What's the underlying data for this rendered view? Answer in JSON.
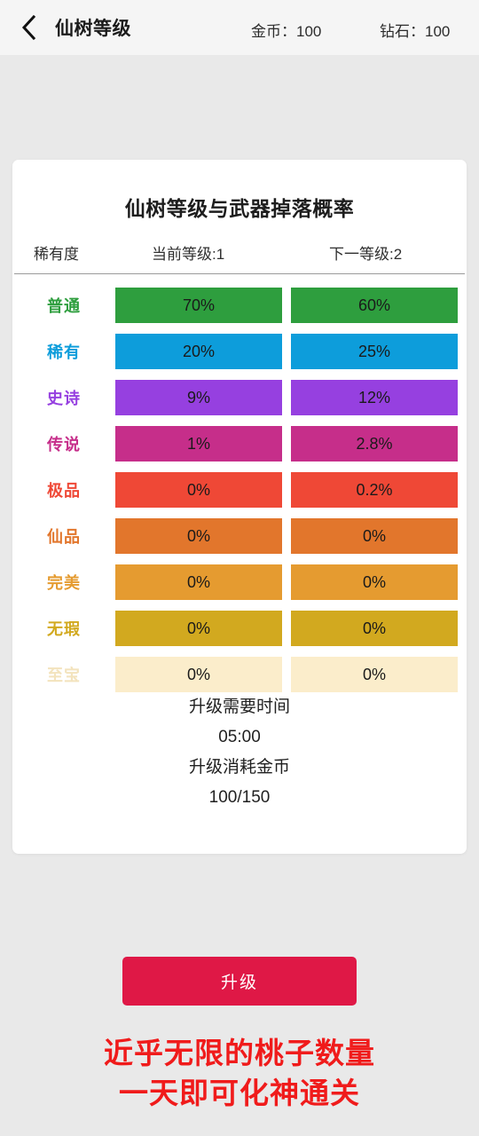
{
  "header": {
    "back_icon": "chevron-left-icon",
    "title": "仙树等级",
    "gold": "金币：100",
    "gem": "钻石：100"
  },
  "card": {
    "title": "仙树等级与武器掉落概率",
    "columns": [
      "稀有度",
      "当前等级:1",
      "下一等级:2"
    ],
    "footer": {
      "time_label": "升级需要时间",
      "time_value": "05:00",
      "cost_label": "升级消耗金币",
      "cost_value": "100/150"
    }
  },
  "upgrade_button": "升级",
  "promo": {
    "line1": "近乎无限的桃子数量",
    "line2": "一天即可化神通关"
  },
  "chart_data": {
    "type": "table",
    "title": "仙树等级与武器掉落概率",
    "columns": [
      "稀有度",
      "当前等级:1",
      "下一等级:2"
    ],
    "categories": [
      "普通",
      "稀有",
      "史诗",
      "传说",
      "极品",
      "仙品",
      "完美",
      "无瑕",
      "至宝"
    ],
    "series": [
      {
        "name": "当前等级:1",
        "values": [
          "70%",
          "20%",
          "9%",
          "1%",
          "0%",
          "0%",
          "0%",
          "0%",
          "0%"
        ]
      },
      {
        "name": "下一等级:2",
        "values": [
          "60%",
          "25%",
          "12%",
          "2.8%",
          "0.2%",
          "0%",
          "0%",
          "0%",
          "0%"
        ]
      }
    ],
    "colors": [
      "#2e9e3e",
      "#0d9ddb",
      "#9640e0",
      "#c62e8a",
      "#ef4836",
      "#e2762c",
      "#e59b30",
      "#d2a91f",
      "#fbedcb"
    ]
  },
  "rows": [
    {
      "rarity": "普通",
      "current": "70%",
      "next": "60%",
      "color": "#2e9e3e",
      "label_color": "#2e9e3e"
    },
    {
      "rarity": "稀有",
      "current": "20%",
      "next": "25%",
      "color": "#0d9ddb",
      "label_color": "#0d9ddb"
    },
    {
      "rarity": "史诗",
      "current": "9%",
      "next": "12%",
      "color": "#9640e0",
      "label_color": "#9640e0"
    },
    {
      "rarity": "传说",
      "current": "1%",
      "next": "2.8%",
      "color": "#c62e8a",
      "label_color": "#c62e8a"
    },
    {
      "rarity": "极品",
      "current": "0%",
      "next": "0.2%",
      "color": "#ef4836",
      "label_color": "#ef4836"
    },
    {
      "rarity": "仙品",
      "current": "0%",
      "next": "0%",
      "color": "#e2762c",
      "label_color": "#e2762c"
    },
    {
      "rarity": "完美",
      "current": "0%",
      "next": "0%",
      "color": "#e59b30",
      "label_color": "#e59b30"
    },
    {
      "rarity": "无瑕",
      "current": "0%",
      "next": "0%",
      "color": "#d2a91f",
      "label_color": "#d2a91f"
    },
    {
      "rarity": "至宝",
      "current": "0%",
      "next": "0%",
      "color": "#fbedcb",
      "label_color": "#f3e3bd"
    }
  ],
  "theme": {
    "page_bg": "#e9e9e9",
    "topbar_bg": "#f5f5f5",
    "card_bg": "#ffffff",
    "accent": "#df1846",
    "promo_color": "#f01b1b"
  }
}
